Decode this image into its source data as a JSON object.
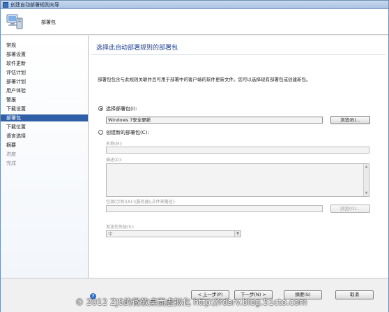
{
  "window": {
    "title": "创建自动部署规则向导"
  },
  "header": {
    "title": "部署包"
  },
  "sidebar": {
    "items": [
      {
        "label": "常规"
      },
      {
        "label": "部署设置"
      },
      {
        "label": "软件更新"
      },
      {
        "label": "评估计划"
      },
      {
        "label": "部署计划"
      },
      {
        "label": "用户体验"
      },
      {
        "label": "警报"
      },
      {
        "label": "下载设置"
      },
      {
        "label": "部署包"
      },
      {
        "label": "下载位置"
      },
      {
        "label": "语言选择"
      },
      {
        "label": "摘要"
      },
      {
        "label": "进度"
      },
      {
        "label": "完成"
      }
    ],
    "active_index": 8
  },
  "main": {
    "title": "选择此自动部署规则的部署包",
    "description": "部署包包含与此规则关联并且可用于部署中的客户端的软件更新文件。您可以选择现有部署包或创建新包。",
    "existing": {
      "label": "选择部署包(I):",
      "value": "Windows 7安全更新",
      "browse_label": "浏览(B)..."
    },
    "create": {
      "label": "创建新的部署包(C):",
      "name_label": "名称(M):",
      "desc_label": "描述(D):",
      "source_label": "包源(示例)(A):\\\\服务器\\\\文件夹路径):",
      "browse_label": "浏览(O)...",
      "priority_label": "发送优先级(S):",
      "priority_value": "中"
    }
  },
  "footer": {
    "help_icon": "?",
    "prev_label": "< 上一步(P)",
    "next_label": "下一步(N) >",
    "summary_label": "摘要(S)",
    "cancel_label": "取消"
  },
  "watermark": "© 2012 ZJS的微软桌面虚拟化 http://rdsrv.blog.51cto.com"
}
